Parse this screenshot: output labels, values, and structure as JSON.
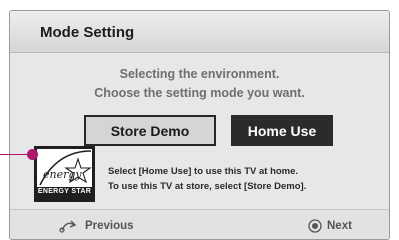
{
  "dialog": {
    "title": "Mode Setting",
    "description_line1": "Selecting the environment.",
    "description_line2": "Choose the setting mode you want.",
    "buttons": {
      "store_demo": "Store Demo",
      "home_use": "Home Use"
    },
    "selected_button": "home_use",
    "energy_logo": {
      "script_text": "energy",
      "label": "ENERGY STAR"
    },
    "info_line1": "Select [Home Use] to use this TV at home.",
    "info_line2": "To use this TV at store, select [Store Demo]."
  },
  "footer": {
    "previous_label": "Previous",
    "next_label": "Next"
  },
  "colors": {
    "callout": "#b0166a",
    "selected_button_bg": "#2b2b2b",
    "unselected_button_bg": "#d5d5d5",
    "dialog_bg": "#e7e7e7"
  },
  "icons": {
    "previous": "back-arrow-icon",
    "next": "ok-button-icon"
  }
}
